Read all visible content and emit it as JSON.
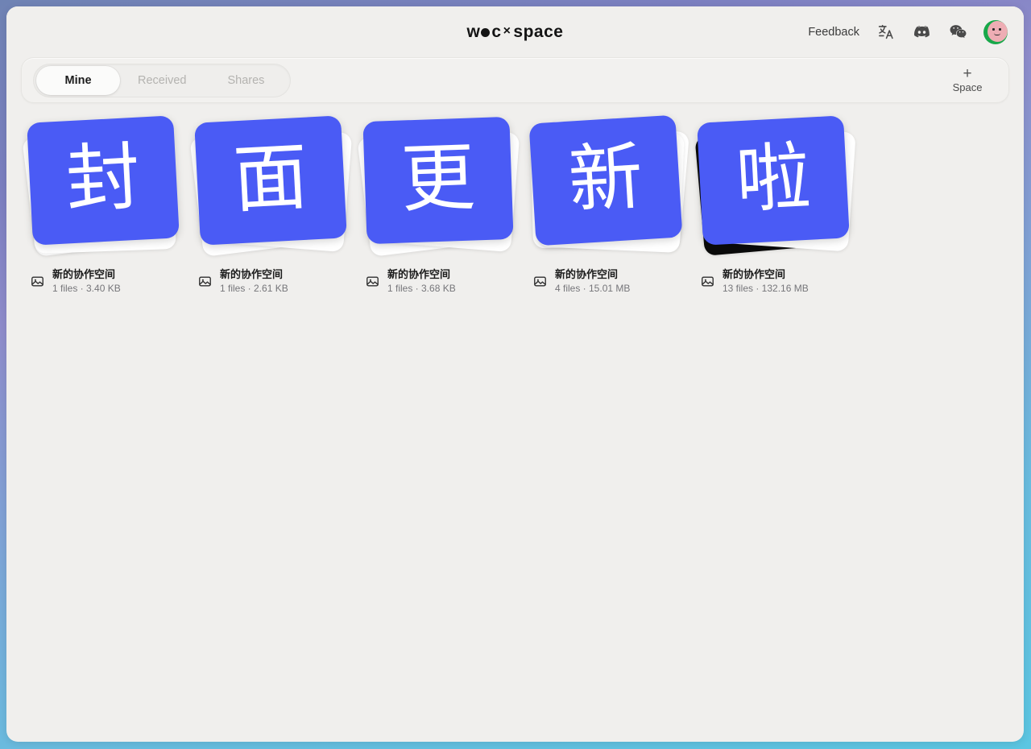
{
  "header": {
    "brand": {
      "prefix": "w",
      "dot": "●",
      "mid": "c",
      "x": "×",
      "suffix": "space",
      "full": "w●c×space"
    },
    "feedback_label": "Feedback",
    "icons": [
      {
        "name": "translate-icon",
        "label": "文A"
      },
      {
        "name": "discord-icon",
        "label": "Discord"
      },
      {
        "name": "wechat-icon",
        "label": "WeChat"
      }
    ],
    "avatar_label": "user-avatar"
  },
  "toolbar": {
    "tabs": [
      {
        "label": "Mine",
        "active": true
      },
      {
        "label": "Received",
        "active": false
      },
      {
        "label": "Shares",
        "active": false
      }
    ],
    "add": {
      "plus": "+",
      "label": "Space"
    }
  },
  "colors": {
    "cover_blue": "#4a5bf5",
    "page_bg": "#f0efed",
    "dark_card": "#0b0b0b",
    "frame_top": "#6f83b4",
    "frame_bottom": "#5bc6e2",
    "accent_green": "#18a84a",
    "avatar_pink": "#eeadb4"
  },
  "spaces": [
    {
      "glyph": "封",
      "title": "新的协作空间",
      "meta": "1 files · 3.40 KB",
      "files": 1,
      "size": "3.40 KB",
      "stack": "white",
      "layers": 2
    },
    {
      "glyph": "面",
      "title": "新的协作空间",
      "meta": "1 files · 2.61 KB",
      "files": 1,
      "size": "2.61 KB",
      "stack": "white",
      "layers": 2
    },
    {
      "glyph": "更",
      "title": "新的协作空间",
      "meta": "1 files · 3.68 KB",
      "files": 1,
      "size": "3.68 KB",
      "stack": "white",
      "layers": 2
    },
    {
      "glyph": "新",
      "title": "新的协作空间",
      "meta": "4 files · 15.01 MB",
      "files": 4,
      "size": "15.01 MB",
      "stack": "photo",
      "layers": 3
    },
    {
      "glyph": "啦",
      "title": "新的协作空间",
      "meta": "13 files · 132.16 MB",
      "files": 13,
      "size": "132.16 MB",
      "stack": "dark",
      "layers": 2
    }
  ]
}
